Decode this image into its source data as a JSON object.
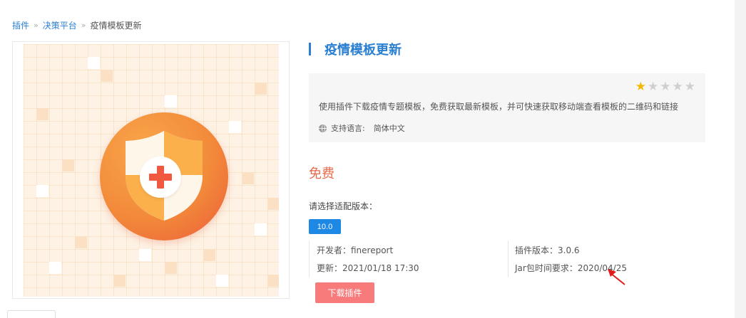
{
  "breadcrumb": {
    "items": [
      "插件",
      "决策平台"
    ],
    "separator": "»",
    "current": "疫情模板更新"
  },
  "plugin": {
    "title": "疫情模板更新",
    "rating": 1,
    "rating_max": 5,
    "description": "使用插件下载疫情专题模板，免费获取最新模板，并可快速获取移动端查看模板的二维码和链接",
    "language_label": "支持语言:",
    "language_value": "简体中文",
    "icon": "shield-plus-icon"
  },
  "pricing": {
    "price": "免费"
  },
  "version": {
    "label": "请选择适配版本：",
    "selected": "10.0"
  },
  "details": {
    "developer": "开发者：finereport",
    "updated": "更新：2021/01/18 17:30",
    "plugin_version": "插件版本：3.0.6",
    "jar_requirement": "Jar包时间要求：2020/04/25"
  },
  "actions": {
    "download_label": "下载插件"
  },
  "colors": {
    "accent": "#2a7fd1",
    "price": "#e8694a",
    "download": "#f77b7b",
    "version": "#1e88e5",
    "star_on": "#f5b800",
    "annotation_arrow": "#e11b1b"
  }
}
